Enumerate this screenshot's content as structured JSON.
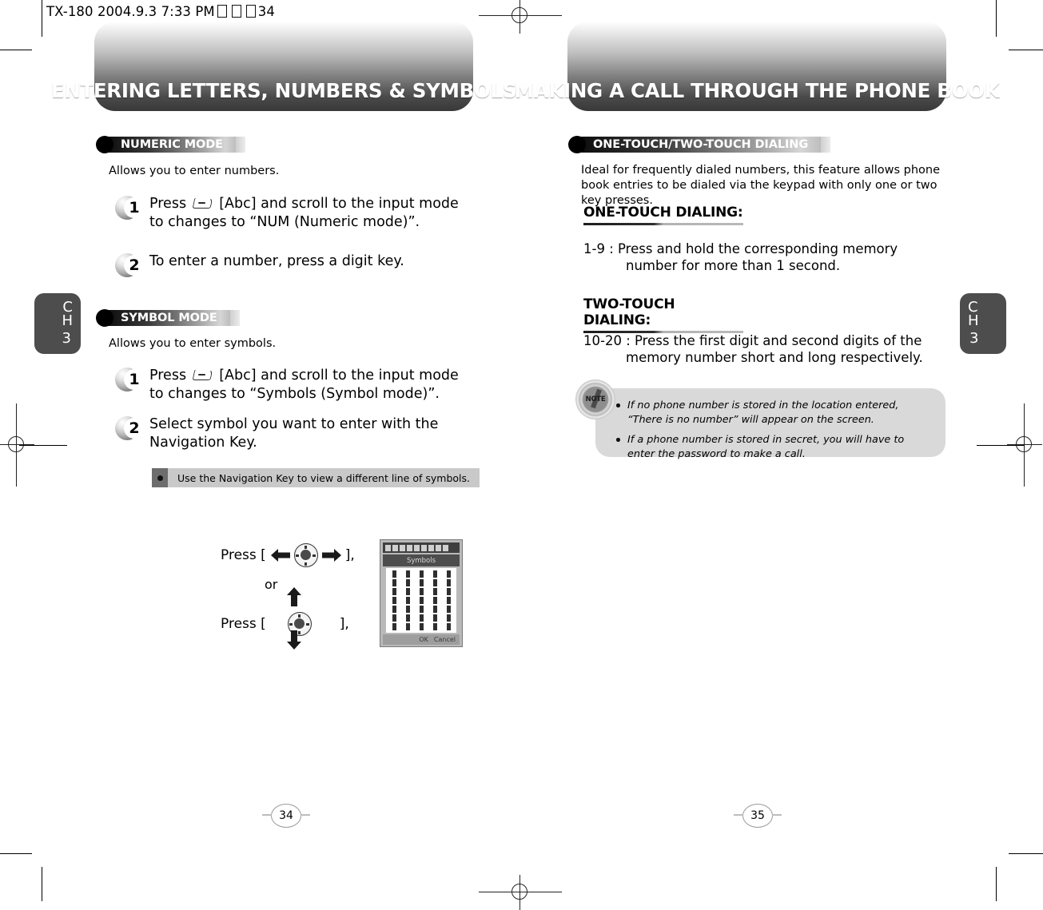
{
  "scan_header": {
    "device": "TX-180",
    "date": "2004.9.3",
    "time": "7:33 PM",
    "page": "34",
    "full_text": "TX-180  2004.9.3 7:33 PM"
  },
  "left_page": {
    "banner_title": "ENTERING LETTERS, NUMBERS & SYMBOLS",
    "chapter_tab": {
      "ch": "C\nH",
      "ch_line1": "C",
      "ch_line2": "H",
      "number": "3"
    },
    "page_number": "34",
    "sections": [
      {
        "bar_label": "NUMERIC MODE",
        "intro": "Allows you to enter numbers.",
        "steps": [
          {
            "num": "1",
            "text_before": "Press",
            "key_icon": "softkey-abc-icon",
            "text_after": "[Abc] and scroll to the input mode to changes to “NUM (Numeric mode)”."
          },
          {
            "num": "2",
            "text_before": "",
            "key_icon": "",
            "text_after": "To enter a number, press a digit key."
          }
        ]
      },
      {
        "bar_label": "SYMBOL MODE",
        "intro": "Allows you to enter symbols.",
        "steps": [
          {
            "num": "1",
            "text_before": "Press",
            "key_icon": "softkey-abc-icon",
            "text_after": "[Abc] and scroll to the input mode to changes to “Symbols (Symbol mode)”."
          },
          {
            "num": "2",
            "text_before": "",
            "key_icon": "",
            "text_after": "Select symbol you want to enter with the Navigation Key."
          }
        ],
        "tip": "Use the Navigation Key to view a different line of symbols."
      }
    ],
    "figure": {
      "press_label_1": "Press [",
      "press_close_1": "],",
      "or_label": "or",
      "press_label_2": "Press [",
      "press_close_2": "],",
      "phone_screen_title": "Symbols",
      "phone_softkey_left": "OK",
      "phone_softkey_right": "Cancel"
    }
  },
  "right_page": {
    "banner_title": "MAKING A CALL THROUGH THE PHONE BOOK",
    "chapter_tab": {
      "ch_line1": "C",
      "ch_line2": "H",
      "number": "3"
    },
    "page_number": "35",
    "section": {
      "bar_label": "ONE-TOUCH/TWO-TOUCH DIALING",
      "intro": "Ideal for frequently dialed numbers, this feature allows phone book entries to be dialed via the keypad with only one or two key presses."
    },
    "subsections": [
      {
        "heading": "ONE-TOUCH DIALING:",
        "range": "1-9 :",
        "line1": "Press and hold the corresponding memory",
        "line2": "number for more than 1 second."
      },
      {
        "heading": "TWO-TOUCH DIALING:",
        "range": "10-20 :",
        "line1": "Press the first digit and second digits of the",
        "line2": "memory number short and long respectively."
      }
    ],
    "note": {
      "icon_label": "NOTE",
      "items": [
        "If no phone number is stored in the location entered, “There is no number” will appear on the screen.",
        "If a phone number is stored in secret, you will have to enter the password to make a call."
      ]
    }
  },
  "colors": {
    "tab_gray": "#4d4d4d",
    "note_bg": "#d9d9d9",
    "tip_bg": "#c9c9c9",
    "tip_marker": "#6d6d6d"
  }
}
